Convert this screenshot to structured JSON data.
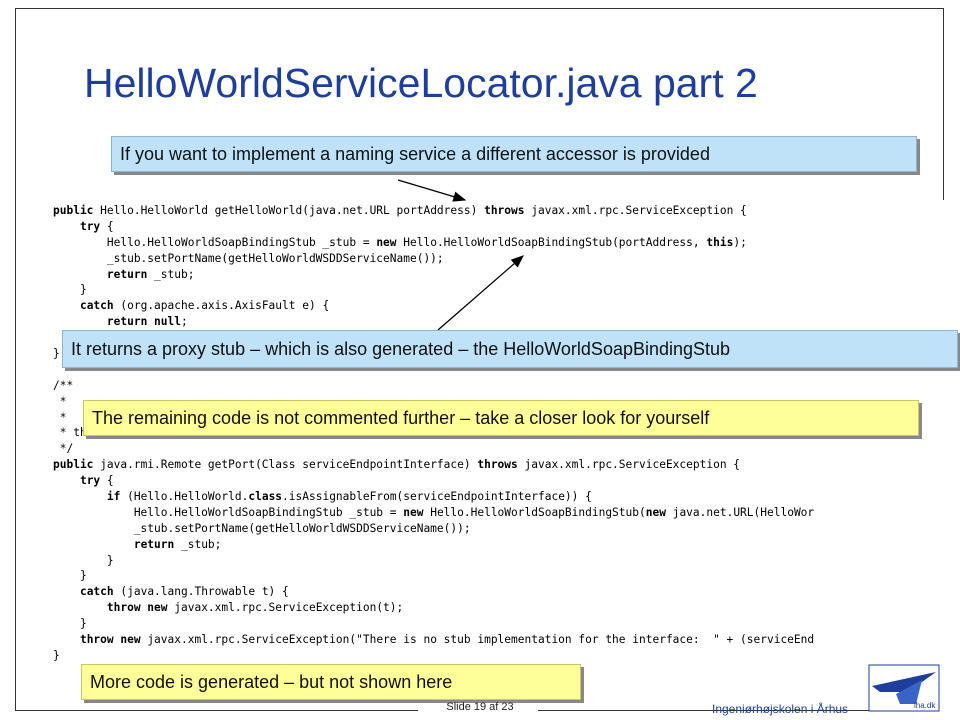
{
  "slide": {
    "title": "HelloWorldServiceLocator.java part 2",
    "footer_slide": "Slide 19 af  23",
    "footer_school": "Ingeniørhøjskolen i Århus",
    "logo_text": "iha.dk"
  },
  "callouts": {
    "naming": "If you want to implement a naming service a different accessor is provided",
    "proxy": "It returns a proxy stub – which is also generated – the HelloWorldSoapBindingStub",
    "remaining": "The remaining code is not commented further – take a closer look for yourself",
    "more": "More code is generated – but not shown here"
  },
  "code_lines": [
    [
      {
        "t": "public",
        "k": true
      },
      {
        "t": " Hello.HelloWorld getHelloWorld(java.net.URL portAddress) "
      },
      {
        "t": "throws",
        "k": true
      },
      {
        "t": " javax.xml.rpc.ServiceException {"
      }
    ],
    [
      {
        "t": "    "
      },
      {
        "t": "try",
        "k": true
      },
      {
        "t": " {"
      }
    ],
    [
      {
        "t": "        Hello.HelloWorldSoapBindingStub _stub = "
      },
      {
        "t": "new",
        "k": true
      },
      {
        "t": " Hello.HelloWorldSoapBindingStub(portAddress, "
      },
      {
        "t": "this",
        "k": true
      },
      {
        "t": ");"
      }
    ],
    [
      {
        "t": "        _stub.setPortName(getHelloWorldWSDDServiceName());"
      }
    ],
    [
      {
        "t": "        "
      },
      {
        "t": "return",
        "k": true
      },
      {
        "t": " _stub;"
      }
    ],
    [
      {
        "t": "    }"
      }
    ],
    [
      {
        "t": "    "
      },
      {
        "t": "catch",
        "k": true
      },
      {
        "t": " (org.apache.axis.AxisFault e) {"
      }
    ],
    [
      {
        "t": "        "
      },
      {
        "t": "return null",
        "k": true
      },
      {
        "t": ";"
      }
    ],
    [
      {
        "t": "    }"
      }
    ],
    [
      {
        "t": "}"
      }
    ],
    [
      {
        "t": ""
      }
    ],
    [
      {
        "t": "/**"
      }
    ],
    [
      {
        "t": " *"
      }
    ],
    [
      {
        "t": " *"
      }
    ],
    [
      {
        "t": " * then ServiceException is thrown."
      }
    ],
    [
      {
        "t": " */"
      }
    ],
    [
      {
        "t": "public",
        "k": true
      },
      {
        "t": " java.rmi.Remote getPort(Class serviceEndpointInterface) "
      },
      {
        "t": "throws",
        "k": true
      },
      {
        "t": " javax.xml.rpc.ServiceException {"
      }
    ],
    [
      {
        "t": "    "
      },
      {
        "t": "try",
        "k": true
      },
      {
        "t": " {"
      }
    ],
    [
      {
        "t": "        "
      },
      {
        "t": "if",
        "k": true
      },
      {
        "t": " (Hello.HelloWorld."
      },
      {
        "t": "class",
        "k": true
      },
      {
        "t": ".isAssignableFrom(serviceEndpointInterface)) {"
      }
    ],
    [
      {
        "t": "            Hello.HelloWorldSoapBindingStub _stub = "
      },
      {
        "t": "new",
        "k": true
      },
      {
        "t": " Hello.HelloWorldSoapBindingStub("
      },
      {
        "t": "new",
        "k": true
      },
      {
        "t": " java.net.URL(HelloWor"
      }
    ],
    [
      {
        "t": "            _stub.setPortName(getHelloWorldWSDDServiceName());"
      }
    ],
    [
      {
        "t": "            "
      },
      {
        "t": "return",
        "k": true
      },
      {
        "t": " _stub;"
      }
    ],
    [
      {
        "t": "        }"
      }
    ],
    [
      {
        "t": "    }"
      }
    ],
    [
      {
        "t": "    "
      },
      {
        "t": "catch",
        "k": true
      },
      {
        "t": " (java.lang.Throwable t) {"
      }
    ],
    [
      {
        "t": "        "
      },
      {
        "t": "throw new",
        "k": true
      },
      {
        "t": " javax.xml.rpc.ServiceException(t);"
      }
    ],
    [
      {
        "t": "    }"
      }
    ],
    [
      {
        "t": "    "
      },
      {
        "t": "throw new",
        "k": true
      },
      {
        "t": " javax.xml.rpc.ServiceException(\"There is no stub implementation for the interface:  \" + (serviceEnd"
      }
    ],
    [
      {
        "t": "}"
      }
    ]
  ]
}
